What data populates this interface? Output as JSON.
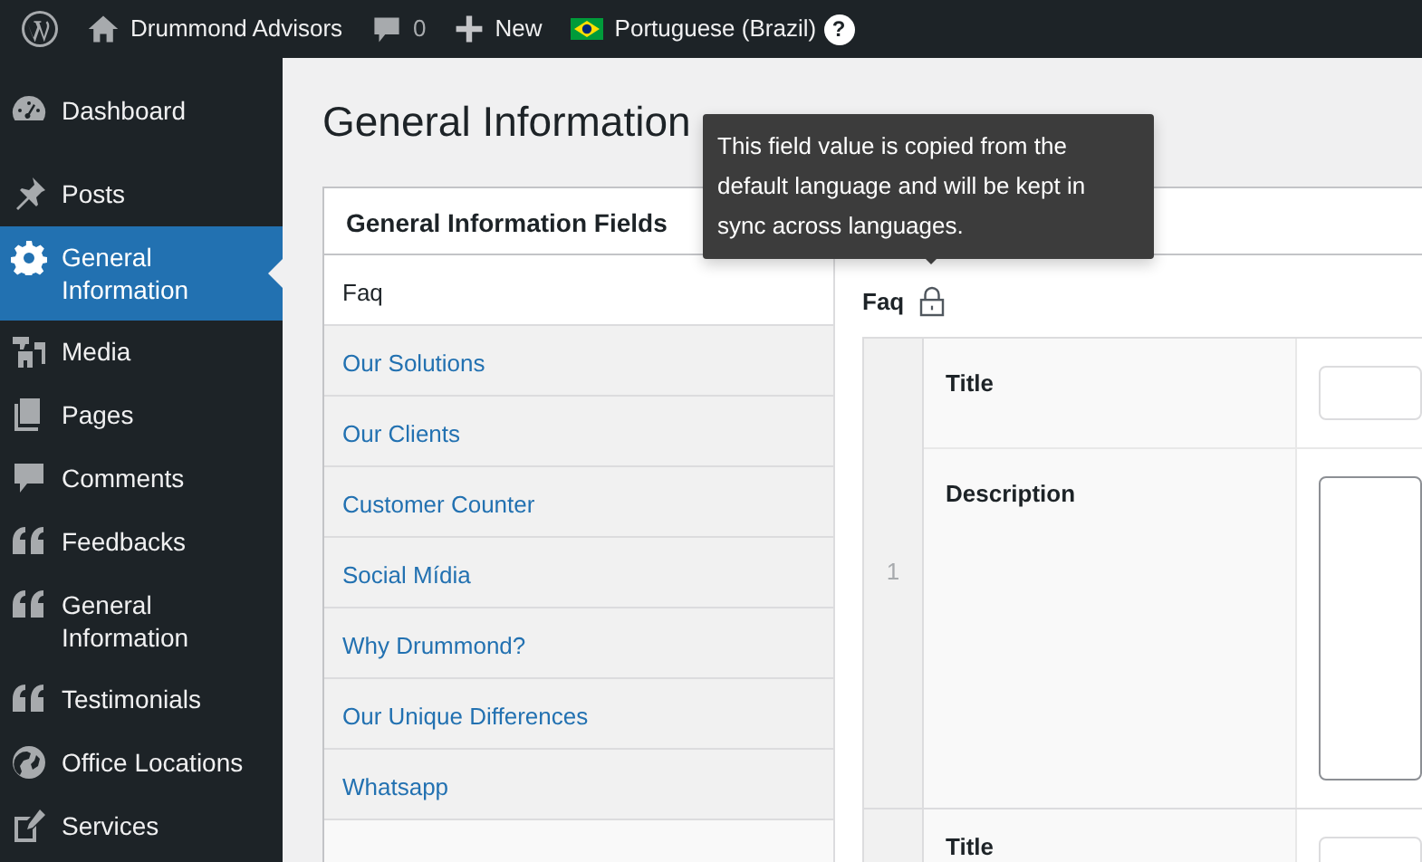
{
  "admin_bar": {
    "site_name": "Drummond Advisors",
    "comments_count": "0",
    "new_label": "New",
    "language": "Portuguese (Brazil)",
    "help_badge": "?"
  },
  "sidebar": {
    "items": [
      {
        "label": "Dashboard",
        "selected": false
      },
      {
        "label": "Posts",
        "selected": false
      },
      {
        "label": "General Information",
        "selected": true
      },
      {
        "label": "Media",
        "selected": false
      },
      {
        "label": "Pages",
        "selected": false
      },
      {
        "label": "Comments",
        "selected": false
      },
      {
        "label": "Feedbacks",
        "selected": false
      },
      {
        "label": "General Information",
        "selected": false
      },
      {
        "label": "Testimonials",
        "selected": false
      },
      {
        "label": "Office Locations",
        "selected": false
      },
      {
        "label": "Services",
        "selected": false
      }
    ]
  },
  "page_title": "General Information",
  "panel": {
    "header": "General Information Fields",
    "tabs": [
      {
        "label": "Faq",
        "selected": true
      },
      {
        "label": "Our Solutions",
        "selected": false
      },
      {
        "label": "Our Clients",
        "selected": false
      },
      {
        "label": "Customer Counter",
        "selected": false
      },
      {
        "label": "Social Mídia",
        "selected": false
      },
      {
        "label": "Why Drummond?",
        "selected": false
      },
      {
        "label": "Our Unique Differences",
        "selected": false
      },
      {
        "label": "Whatsapp",
        "selected": false
      }
    ],
    "field": {
      "label": "Faq",
      "locked": true,
      "tooltip": "This field value is copied from the default language and will be kept in sync across languages."
    },
    "rows": [
      {
        "index": "1",
        "fields": [
          {
            "label": "Title",
            "kind": "text"
          },
          {
            "label": "Description",
            "kind": "textarea"
          }
        ]
      },
      {
        "fields": [
          {
            "label": "Title",
            "kind": "text"
          }
        ]
      }
    ]
  }
}
